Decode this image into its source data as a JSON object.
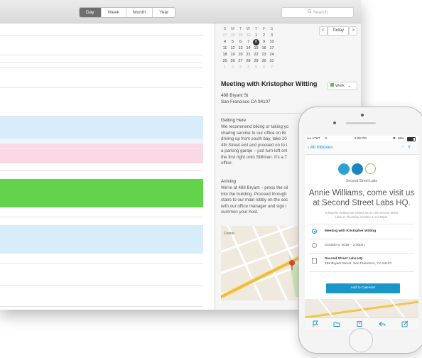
{
  "calendar": {
    "view_tabs": [
      "Day",
      "Week",
      "Month",
      "Year"
    ],
    "active_view": "Day",
    "search_placeholder": "Search",
    "nav": {
      "prev": "<",
      "today": "Today",
      "next": ">"
    },
    "mini_cal": {
      "weekdays": [
        "S",
        "M",
        "T",
        "W",
        "T",
        "F",
        "S"
      ],
      "weeks": [
        [
          "27",
          "28",
          "29",
          "30",
          "1",
          "2",
          "3"
        ],
        [
          "4",
          "5",
          "6",
          "7",
          "8",
          "9",
          "10"
        ],
        [
          "11",
          "12",
          "13",
          "14",
          "15",
          "16",
          "17"
        ],
        [
          "18",
          "19",
          "20",
          "21",
          "22",
          "23",
          "24"
        ],
        [
          "25",
          "26",
          "27",
          "28",
          "29",
          "30",
          "31"
        ],
        [
          "1",
          "2",
          "3",
          "4",
          "5",
          "6",
          "7"
        ]
      ],
      "selected": "8"
    },
    "event": {
      "title": "Meeting with Kristopher Witting",
      "calendar": "Work",
      "address_line1": "488 Bryant St",
      "address_line2": "San Francisco CA 94107",
      "getting_here_heading": "Getting Here",
      "getting_here_lines": [
        "We recommend biking or taking yo",
        "sharing service to our office on Br",
        "driving up from south bay, take 10",
        "4th Street exit and proceed on to t",
        "a parking garaje – just turn left onl",
        "the first right onto Stillman. It's a 7",
        "office."
      ],
      "arriving_heading": "Arriving",
      "arriving_lines": [
        "We're at 488 Bryant – press the sil",
        "into the building. Proceed through",
        "stairs to our main lobby on the sec",
        "with our office manager and sign i",
        "summon your host."
      ],
      "map_label": "Center"
    },
    "colors": {
      "blue_event": "#d8ecf9",
      "pink_event": "#fbd8e6",
      "green_event": "#63d34b",
      "work_swatch": "#5bc34b"
    }
  },
  "phone": {
    "status": {
      "carrier": "•••• AT&T",
      "time": "6:28 PM",
      "battery": "86%"
    },
    "nav": {
      "back_label": "All Inboxes",
      "arrows": "^ v"
    },
    "brand": "Second Street Labs",
    "headline_line1": "Annie Williams, come visit us",
    "headline_line2": "at Second Street Labs HQ.",
    "invite_line1": "Kristopher Witting has invited you to visit Second Street",
    "invite_line2": "Labs on Thursday, October 8 at 2:00pm.",
    "rows": [
      {
        "text": "Meeting with Kristopher Witting",
        "icon": "radio-icon"
      },
      {
        "text": "October 8, 2015 – 2:00pm.",
        "icon": "clock-icon"
      },
      {
        "text": "Second Street Labs HQ",
        "sub": "488 Bryant Street, San Francisco, CA 94107",
        "icon": "pin-icon"
      }
    ],
    "cta_label": "Add to Calendar",
    "accent": "#1a8ed1"
  }
}
